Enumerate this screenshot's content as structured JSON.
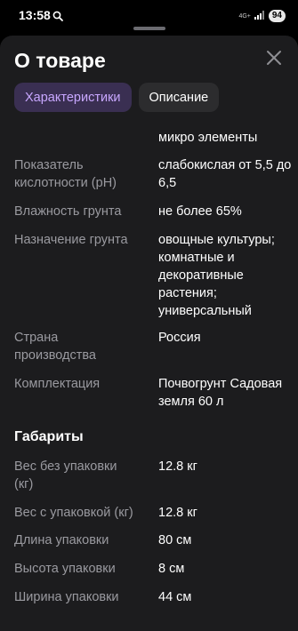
{
  "status_bar": {
    "time": "13:58",
    "network": "4G+",
    "battery": "94"
  },
  "sheet": {
    "title": "О товаре",
    "tabs": [
      {
        "label": "Характеристики",
        "active": true
      },
      {
        "label": "Описание",
        "active": false
      }
    ]
  },
  "specs": {
    "partial_value": "микро элементы",
    "rows": [
      {
        "label": "Показатель кислотности (pH)",
        "value": "слабокислая от 5,5 до 6,5"
      },
      {
        "label": "Влажность грунта",
        "value": "не более 65%"
      },
      {
        "label": "Назначение грунта",
        "value": "овощные культуры; комнатные и декоративные растения; универсальный"
      },
      {
        "label": "Страна производства",
        "value": "Россия"
      },
      {
        "label": "Комплектация",
        "value": "Почвогрунт Садовая земля 60 л"
      }
    ]
  },
  "dimensions": {
    "title": "Габариты",
    "rows": [
      {
        "label": "Вес без упаковки (кг)",
        "value": "12.8 кг"
      },
      {
        "label": "Вес с упаковкой (кг)",
        "value": "12.8 кг"
      },
      {
        "label": "Длина упаковки",
        "value": "80 см"
      },
      {
        "label": "Высота упаковки",
        "value": "8 см"
      },
      {
        "label": "Ширина упаковки",
        "value": "44 см"
      }
    ]
  },
  "colors": {
    "accent_text": "#c8a7ff",
    "accent_bg": "#3a2f52",
    "sheet_bg": "#1c1c1e"
  }
}
